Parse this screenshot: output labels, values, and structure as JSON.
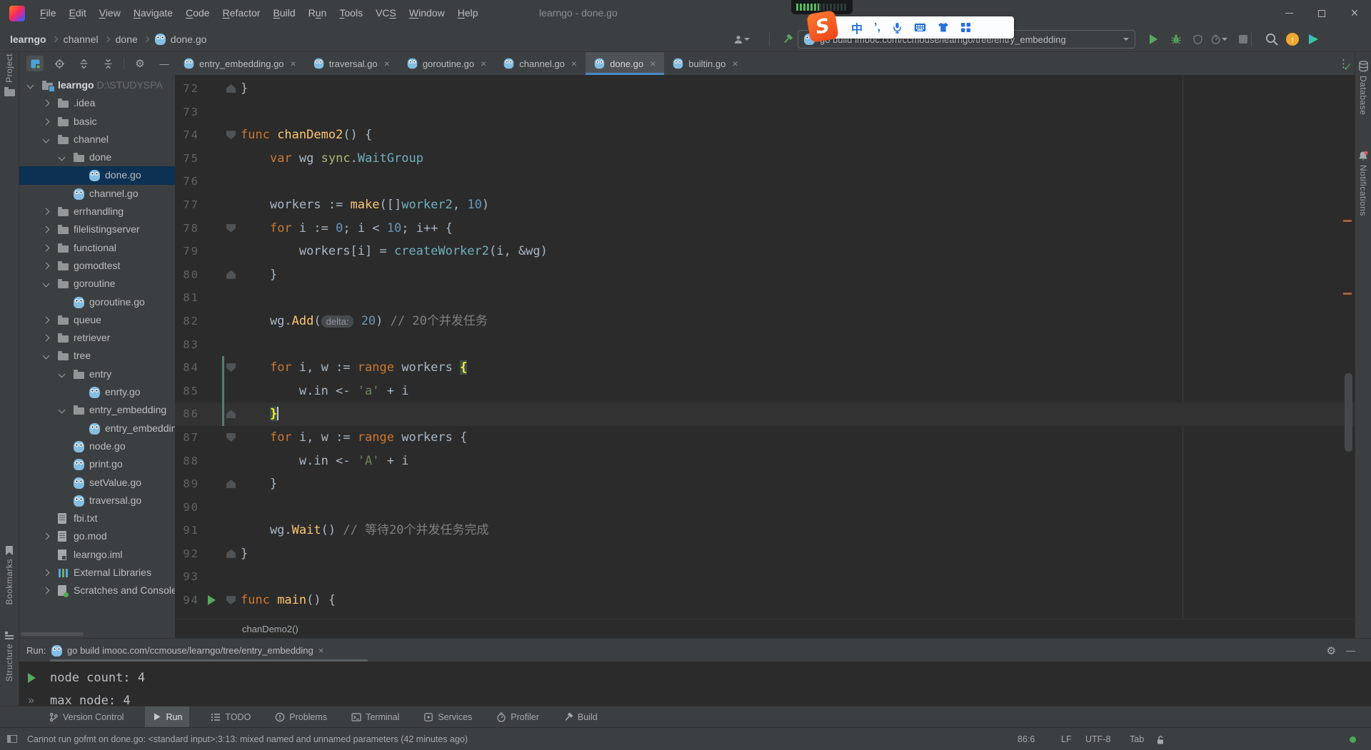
{
  "colors": {
    "frame": "#3C3F41",
    "editor_bg": "#2B2B2B",
    "selection": "#0D3153",
    "tab_underline": "#4A88C7",
    "keyword": "#CC7832",
    "function": "#FFC66D",
    "type": "#6FAFBD",
    "number": "#6897BB",
    "string": "#6A8759",
    "comment": "#808080",
    "run_green": "#57A85C",
    "update_orange": "#F0A732"
  },
  "titlebar": {
    "title": "learngo - done.go",
    "menu": [
      {
        "label": "File",
        "u": 0
      },
      {
        "label": "Edit",
        "u": 0
      },
      {
        "label": "View",
        "u": 0
      },
      {
        "label": "Navigate",
        "u": 0
      },
      {
        "label": "Code",
        "u": 0
      },
      {
        "label": "Refactor",
        "u": 0
      },
      {
        "label": "Build",
        "u": 0
      },
      {
        "label": "Run",
        "u": 1
      },
      {
        "label": "Tools",
        "u": 0
      },
      {
        "label": "VCS",
        "u": 2
      },
      {
        "label": "Window",
        "u": 0
      },
      {
        "label": "Help",
        "u": 0
      }
    ]
  },
  "navbar": {
    "breadcrumbs": [
      "learngo",
      "channel",
      "done",
      "done.go"
    ],
    "run_config": "go build imooc.com/ccmouse/learngo/tree/entry_embedding"
  },
  "sogou": {
    "logo": "S",
    "lang": "中",
    "punct": "’,"
  },
  "left_strip": {
    "project": "Project",
    "bookmarks": "Bookmarks",
    "structure": "Structure"
  },
  "right_strip": {
    "database": "Database",
    "notifications": "Notifications"
  },
  "project": {
    "tree": [
      {
        "d": 0,
        "chev": "open",
        "icon": "folder-root",
        "label": "learngo",
        "extra": " D:\\STUDYSPA",
        "bold": true
      },
      {
        "d": 1,
        "chev": "closed",
        "icon": "folder",
        "label": ".idea"
      },
      {
        "d": 1,
        "chev": "closed",
        "icon": "folder",
        "label": "basic"
      },
      {
        "d": 1,
        "chev": "open",
        "icon": "folder",
        "label": "channel"
      },
      {
        "d": 2,
        "chev": "open",
        "icon": "folder",
        "label": "done"
      },
      {
        "d": 3,
        "icon": "go",
        "label": "done.go",
        "selected": true
      },
      {
        "d": 2,
        "icon": "go",
        "label": "channel.go"
      },
      {
        "d": 1,
        "chev": "closed",
        "icon": "folder",
        "label": "errhandling"
      },
      {
        "d": 1,
        "chev": "closed",
        "icon": "folder",
        "label": "filelistingserver"
      },
      {
        "d": 1,
        "chev": "closed",
        "icon": "folder",
        "label": "functional"
      },
      {
        "d": 1,
        "chev": "closed",
        "icon": "folder",
        "label": "gomodtest"
      },
      {
        "d": 1,
        "chev": "open",
        "icon": "folder",
        "label": "goroutine"
      },
      {
        "d": 2,
        "icon": "go",
        "label": "goroutine.go"
      },
      {
        "d": 1,
        "chev": "closed",
        "icon": "folder",
        "label": "queue"
      },
      {
        "d": 1,
        "chev": "closed",
        "icon": "folder",
        "label": "retriever"
      },
      {
        "d": 1,
        "chev": "open",
        "icon": "folder",
        "label": "tree"
      },
      {
        "d": 2,
        "chev": "open",
        "icon": "folder",
        "label": "entry"
      },
      {
        "d": 3,
        "icon": "go",
        "label": "enrty.go"
      },
      {
        "d": 2,
        "chev": "open",
        "icon": "folder",
        "label": "entry_embedding"
      },
      {
        "d": 3,
        "icon": "go",
        "label": "entry_embedding.go"
      },
      {
        "d": 2,
        "icon": "go",
        "label": "node.go"
      },
      {
        "d": 2,
        "icon": "go",
        "label": "print.go"
      },
      {
        "d": 2,
        "icon": "go",
        "label": "setValue.go"
      },
      {
        "d": 2,
        "icon": "go",
        "label": "traversal.go"
      },
      {
        "d": 1,
        "icon": "txt",
        "label": "fbi.txt"
      },
      {
        "d": 1,
        "chev": "closed",
        "icon": "txt",
        "label": "go.mod"
      },
      {
        "d": 1,
        "icon": "iml",
        "label": "learngo.iml"
      },
      {
        "d": 1,
        "chev": "closed",
        "icon": "lib",
        "label": "External Libraries"
      },
      {
        "d": 1,
        "chev": "closed",
        "icon": "scratch",
        "label": "Scratches and Consoles"
      }
    ]
  },
  "tabs": [
    {
      "label": "entry_embedding.go"
    },
    {
      "label": "traversal.go"
    },
    {
      "label": "goroutine.go"
    },
    {
      "label": "channel.go"
    },
    {
      "label": "done.go",
      "active": true
    },
    {
      "label": "builtin.go"
    }
  ],
  "editor": {
    "breadcrumb": "chanDemo2()",
    "lines": [
      {
        "n": 72,
        "fold": "up",
        "t": [
          [
            "d",
            "}"
          ]
        ]
      },
      {
        "n": 73,
        "t": []
      },
      {
        "n": 74,
        "fold": "down",
        "t": [
          [
            "k",
            "func "
          ],
          [
            "fn",
            "chanDemo2"
          ],
          [
            "d",
            "() {"
          ]
        ]
      },
      {
        "n": 75,
        "t": [
          [
            "d",
            "    "
          ],
          [
            "k",
            "var"
          ],
          [
            "d",
            " wg "
          ],
          [
            "pkg",
            "sync"
          ],
          [
            "d",
            "."
          ],
          [
            "ty",
            "WaitGroup"
          ]
        ]
      },
      {
        "n": 76,
        "t": []
      },
      {
        "n": 77,
        "t": [
          [
            "d",
            "    workers := "
          ],
          [
            "fn",
            "make"
          ],
          [
            "d",
            "([]"
          ],
          [
            "ty",
            "worker2"
          ],
          [
            "d",
            ", "
          ],
          [
            "n",
            "10"
          ],
          [
            "d",
            ")"
          ]
        ]
      },
      {
        "n": 78,
        "fold": "down",
        "t": [
          [
            "d",
            "    "
          ],
          [
            "k",
            "for"
          ],
          [
            "d",
            " i := "
          ],
          [
            "n",
            "0"
          ],
          [
            "d",
            "; i < "
          ],
          [
            "n",
            "10"
          ],
          [
            "d",
            "; i++ {"
          ]
        ]
      },
      {
        "n": 79,
        "t": [
          [
            "d",
            "        workers[i] = "
          ],
          [
            "ty",
            "createWorker2"
          ],
          [
            "d",
            "(i, &wg)"
          ]
        ]
      },
      {
        "n": 80,
        "fold": "up",
        "t": [
          [
            "d",
            "    }"
          ]
        ]
      },
      {
        "n": 81,
        "t": []
      },
      {
        "n": 82,
        "t": [
          [
            "d",
            "    wg."
          ],
          [
            "fn",
            "Add"
          ],
          [
            "d",
            "("
          ],
          [
            "hint",
            "delta:"
          ],
          [
            "d",
            " "
          ],
          [
            "n",
            "20"
          ],
          [
            "d",
            ") "
          ],
          [
            "c",
            "// 20个并发任务"
          ]
        ]
      },
      {
        "n": 83,
        "t": []
      },
      {
        "n": 84,
        "fold": "down",
        "chg": true,
        "t": [
          [
            "d",
            "    "
          ],
          [
            "k",
            "for"
          ],
          [
            "d",
            " i, w := "
          ],
          [
            "k",
            "range"
          ],
          [
            "d",
            " workers "
          ],
          [
            "brace",
            "{"
          ]
        ]
      },
      {
        "n": 85,
        "chg": true,
        "t": [
          [
            "d",
            "        w.in <- "
          ],
          [
            "s",
            "'a'"
          ],
          [
            "d",
            " + i"
          ]
        ]
      },
      {
        "n": 86,
        "fold": "up",
        "chg": true,
        "cur": true,
        "caret": true,
        "t": [
          [
            "d",
            "    "
          ],
          [
            "brace",
            "}"
          ]
        ]
      },
      {
        "n": 87,
        "fold": "down",
        "t": [
          [
            "d",
            "    "
          ],
          [
            "k",
            "for"
          ],
          [
            "d",
            " i, w := "
          ],
          [
            "k",
            "range"
          ],
          [
            "d",
            " workers {"
          ]
        ]
      },
      {
        "n": 88,
        "t": [
          [
            "d",
            "        w.in <- "
          ],
          [
            "s",
            "'A'"
          ],
          [
            "d",
            " + i"
          ]
        ]
      },
      {
        "n": 89,
        "fold": "up",
        "t": [
          [
            "d",
            "    }"
          ]
        ]
      },
      {
        "n": 90,
        "t": []
      },
      {
        "n": 91,
        "t": [
          [
            "d",
            "    wg."
          ],
          [
            "fn",
            "Wait"
          ],
          [
            "d",
            "() "
          ],
          [
            "c",
            "// 等待20个并发任务完成"
          ]
        ]
      },
      {
        "n": 92,
        "fold": "up",
        "t": [
          [
            "d",
            "}"
          ]
        ]
      },
      {
        "n": 93,
        "t": []
      },
      {
        "n": 94,
        "fold": "down",
        "run": true,
        "t": [
          [
            "k",
            "func "
          ],
          [
            "fn",
            "main"
          ],
          [
            "d",
            "() {"
          ]
        ]
      }
    ]
  },
  "run_panel": {
    "label": "Run:",
    "tab": "go build imooc.com/ccmouse/learngo/tree/entry_embedding",
    "output": [
      {
        "icon": "play",
        "text": "node count:  4"
      },
      {
        "icon": "chevrons",
        "text": "max node:  4"
      }
    ]
  },
  "bottom_bar": [
    {
      "icon": "branch",
      "label": "Version Control"
    },
    {
      "icon": "play",
      "label": "Run",
      "active": true
    },
    {
      "icon": "list",
      "label": "TODO"
    },
    {
      "icon": "problems",
      "label": "Problems"
    },
    {
      "icon": "terminal",
      "label": "Terminal"
    },
    {
      "icon": "services",
      "label": "Services"
    },
    {
      "icon": "profiler",
      "label": "Profiler"
    },
    {
      "icon": "hammer",
      "label": "Build"
    }
  ],
  "status_bar": {
    "message": "Cannot run gofmt on done.go: <standard input>:3:13: mixed named and unnamed parameters (42 minutes ago)",
    "position": "86:6",
    "line_sep": "LF",
    "encoding": "UTF-8",
    "indent": "Tab"
  }
}
